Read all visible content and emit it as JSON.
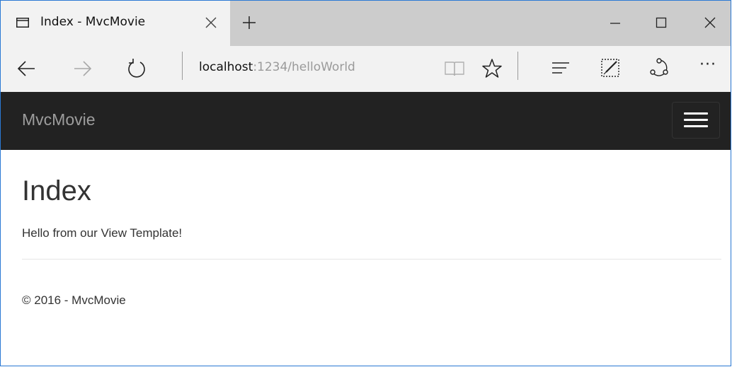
{
  "browser": {
    "tab": {
      "title": "Index - MvcMovie",
      "icon": "tab-page-icon",
      "close_icon": "close-icon"
    },
    "new_tab_icon": "plus-icon",
    "window_controls": [
      "minimize-icon",
      "maximize-icon",
      "close-icon"
    ],
    "address_bar": {
      "host": "localhost",
      "path": ":1234/helloWorld"
    },
    "nav_icons": [
      "back-icon",
      "forward-icon",
      "refresh-icon"
    ],
    "toolbar_icons": [
      "reading-view-icon",
      "favorite-star-icon",
      "hub-icon",
      "web-note-icon",
      "share-icon",
      "more-icon"
    ],
    "more_label": "···"
  },
  "site": {
    "brand": "MvcMovie",
    "menu_icon": "hamburger-menu-icon",
    "header_bg": "#222222",
    "brand_color": "#9d9d9d"
  },
  "page": {
    "title": "Index",
    "message": "Hello from our View Template!",
    "footer": "© 2016 - MvcMovie"
  }
}
